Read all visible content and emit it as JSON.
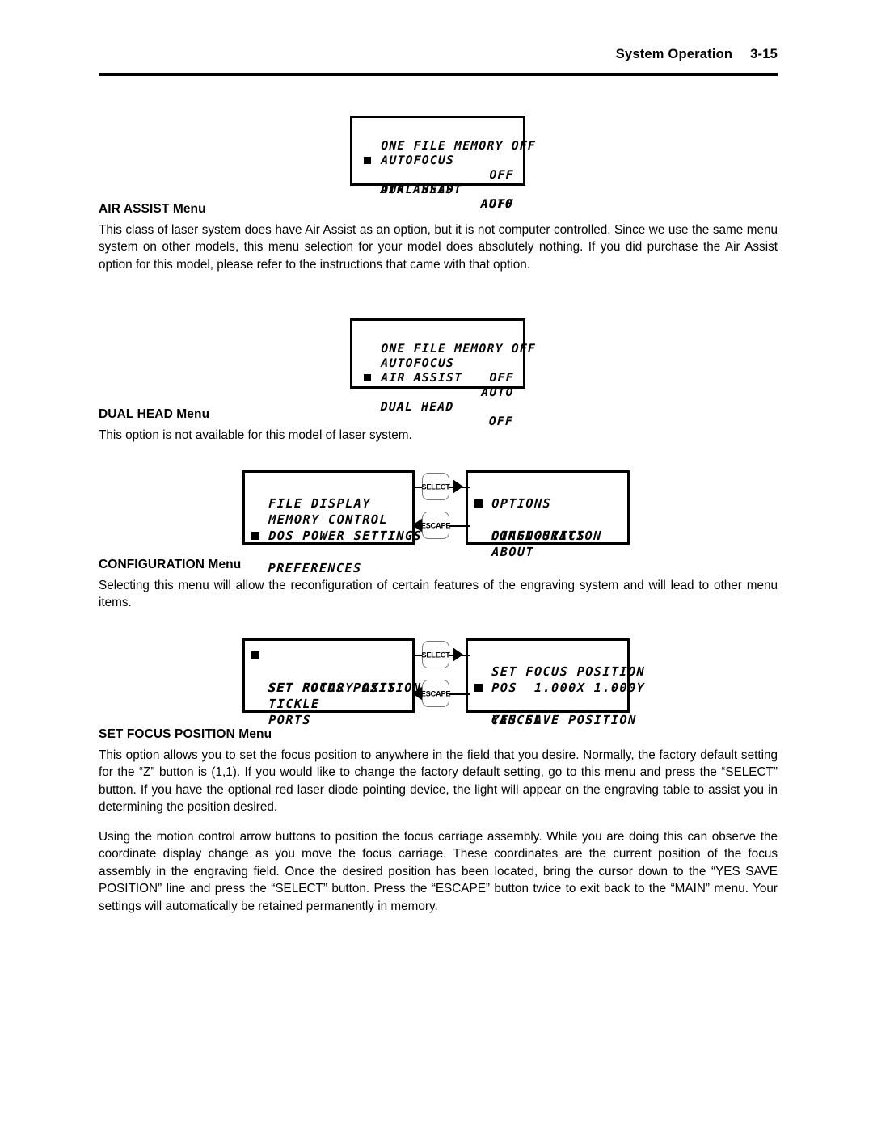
{
  "header": {
    "title": "System Operation",
    "page_number": "3-15"
  },
  "sections": [
    {
      "heading": "AIR ASSIST Menu",
      "body": "This class of laser system does have Air Assist as an option, but it is not computer controlled.  Since we use the same menu system on other models, this menu selection for your model does absolutely nothing.  If you did purchase the Air Assist option for this model, please refer to the instructions that came with that option."
    },
    {
      "heading": "DUAL HEAD Menu",
      "body": "This option is not available for this model of laser system."
    },
    {
      "heading": "CONFIGURATION Menu",
      "body": "Selecting this menu will allow the reconfiguration of certain features of the engraving system and will lead to other menu items."
    },
    {
      "heading": "SET FOCUS POSITION Menu",
      "body": "This option allows you to set the focus position to anywhere in the field that you desire.  Normally, the factory default setting for the “Z” button is (1,1).  If you would like to change the factory default setting, go to this menu and press the “SELECT” button.  If you have the optional red laser diode pointing device, the light will appear on the engraving table to assist you in determining the position desired.",
      "body2": "Using the motion control arrow buttons to position the focus carriage assembly.  While you are doing this can observe the coordinate display change as you move the focus carriage.  These coordinates are the current position of the focus assembly in the engraving field.  Once the desired position has been located, bring the cursor down to the “YES SAVE POSITION” line and press the “SELECT” button.  Press the “ESCAPE” button twice to exit back to the “MAIN” menu.  Your settings will automatically be retained permanently in memory."
    }
  ],
  "lcd_panels": {
    "air_assist": {
      "lines": [
        {
          "cursor": false,
          "left": "ONE FILE MEMORY OFF",
          "right": ""
        },
        {
          "cursor": false,
          "left": "AUTOFOCUS",
          "right": "OFF"
        },
        {
          "cursor": true,
          "left": "AIR ASSIST",
          "right": "AUTO"
        },
        {
          "cursor": false,
          "left": "DUAL HEAD",
          "right": "OFF"
        }
      ]
    },
    "dual_head": {
      "lines": [
        {
          "cursor": false,
          "left": "ONE FILE MEMORY OFF",
          "right": ""
        },
        {
          "cursor": false,
          "left": "AUTOFOCUS",
          "right": "OFF"
        },
        {
          "cursor": false,
          "left": "AIR ASSIST",
          "right": "AUTO"
        },
        {
          "cursor": true,
          "left": "DUAL HEAD",
          "right": "OFF"
        }
      ]
    },
    "preferences": {
      "lines": [
        {
          "cursor": false,
          "left": "FILE DISPLAY",
          "right": ""
        },
        {
          "cursor": false,
          "left": "MEMORY CONTROL",
          "right": ""
        },
        {
          "cursor": false,
          "left": "DOS POWER SETTINGS",
          "right": ""
        },
        {
          "cursor": true,
          "left": "PREFERENCES",
          "right": ""
        }
      ]
    },
    "options": {
      "lines": [
        {
          "cursor": false,
          "left": "OPTIONS",
          "right": ""
        },
        {
          "cursor": true,
          "left": "CONFIGURATION",
          "right": ""
        },
        {
          "cursor": false,
          "left": "DIAGNOSTICS",
          "right": ""
        },
        {
          "cursor": false,
          "left": "ABOUT",
          "right": ""
        }
      ]
    },
    "configuration": {
      "lines": [
        {
          "cursor": true,
          "left": "SET FOCUS POSITION",
          "right": ""
        },
        {
          "cursor": false,
          "left": "SET ROTARY AXIS",
          "right": ""
        },
        {
          "cursor": false,
          "left": "TICKLE",
          "right": ""
        },
        {
          "cursor": false,
          "left": "PORTS",
          "right": ""
        }
      ]
    },
    "set_focus_position": {
      "lines": [
        {
          "cursor": false,
          "left": "SET FOCUS POSITION",
          "right": ""
        },
        {
          "cursor": false,
          "left": "POS  1.000X 1.000Y",
          "right": ""
        },
        {
          "cursor": true,
          "left": "CANCEL",
          "right": ""
        },
        {
          "cursor": false,
          "left": "YES SAVE POSITION",
          "right": ""
        }
      ]
    }
  },
  "buttons": {
    "select": "SELECT",
    "escape": "ESCAPE"
  }
}
